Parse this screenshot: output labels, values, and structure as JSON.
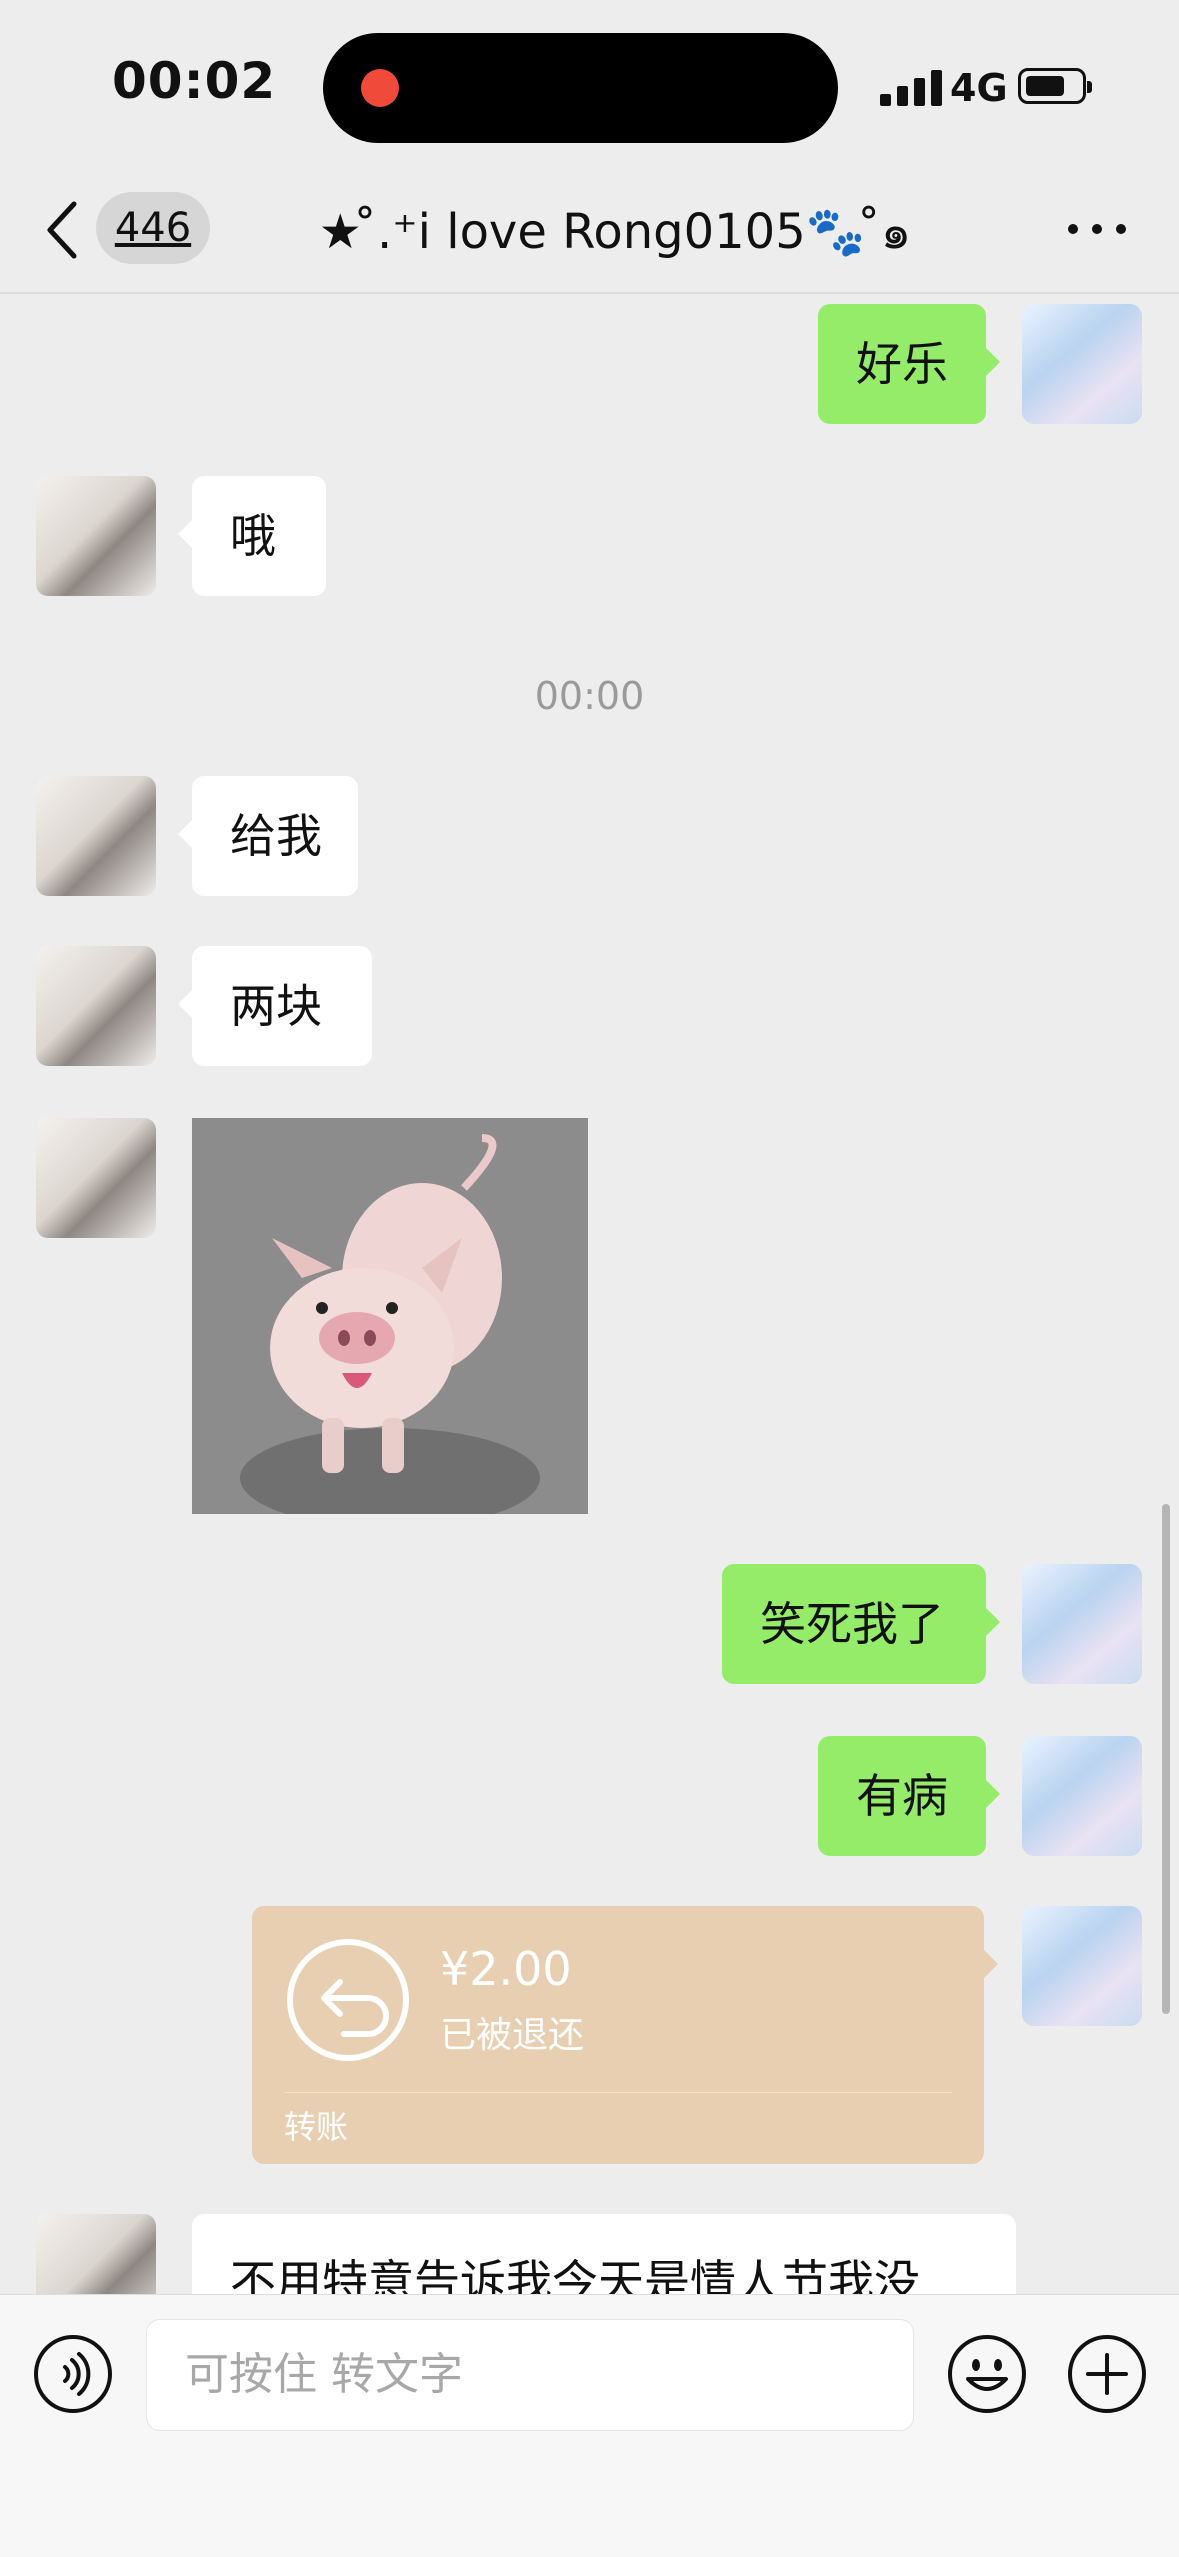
{
  "status_bar": {
    "time": "00:02",
    "network": "4G"
  },
  "nav": {
    "unread_count": "446",
    "title": "★ ̊.⁺i love Rong0105🐾 ̊๑"
  },
  "messages": {
    "m1": "好乐",
    "m2": "哦",
    "timestamp": "00:00",
    "m3": "给我",
    "m4": "两块",
    "m5": "笑死我了",
    "m6": "有病",
    "m7": "不用特意告诉我今天是情人节我没"
  },
  "transfer": {
    "amount": "¥2.00",
    "status": "已被退还",
    "label": "转账"
  },
  "input": {
    "placeholder": "可按住 转文字"
  },
  "colors": {
    "outgoing_bubble": "#95ec69",
    "transfer_card": "#e8cfb1",
    "background": "#ededed"
  },
  "icons": {
    "back": "chevron-left-icon",
    "more": "more-dots-icon",
    "voice": "voice-icon",
    "emoji": "emoji-icon",
    "plus": "plus-icon",
    "transfer": "return-arrow-icon",
    "recording": "recording-dot-icon"
  }
}
